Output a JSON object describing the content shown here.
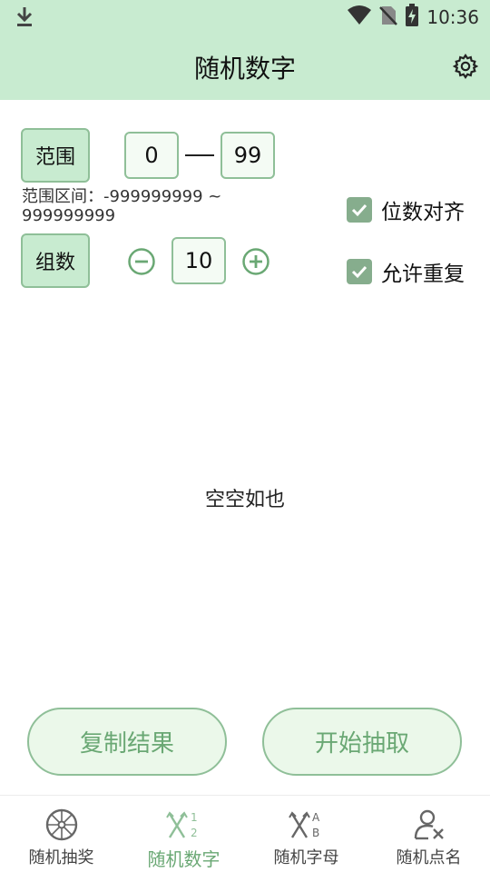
{
  "status": {
    "time": "10:36"
  },
  "appbar": {
    "title": "随机数字"
  },
  "range": {
    "label": "范围",
    "min": "0",
    "max": "99",
    "hint": "范围区间：-999999999 ~ 999999999"
  },
  "groups": {
    "label": "组数",
    "value": "10"
  },
  "options": {
    "align_digits": "位数对齐",
    "allow_repeat": "允许重复"
  },
  "result": {
    "empty_text": "空空如也"
  },
  "actions": {
    "copy": "复制结果",
    "start": "开始抽取"
  },
  "nav": {
    "items": [
      {
        "label": "随机抽奖",
        "icon": "wheel-icon"
      },
      {
        "label": "随机数字",
        "icon": "number-shuffle-icon"
      },
      {
        "label": "随机字母",
        "icon": "letter-shuffle-icon"
      },
      {
        "label": "随机点名",
        "icon": "person-pick-icon"
      }
    ]
  },
  "colors": {
    "header_bg": "#c8ebd0",
    "accent": "#6aa874",
    "border": "#8fbf98",
    "checkbox": "#86ad8d"
  }
}
